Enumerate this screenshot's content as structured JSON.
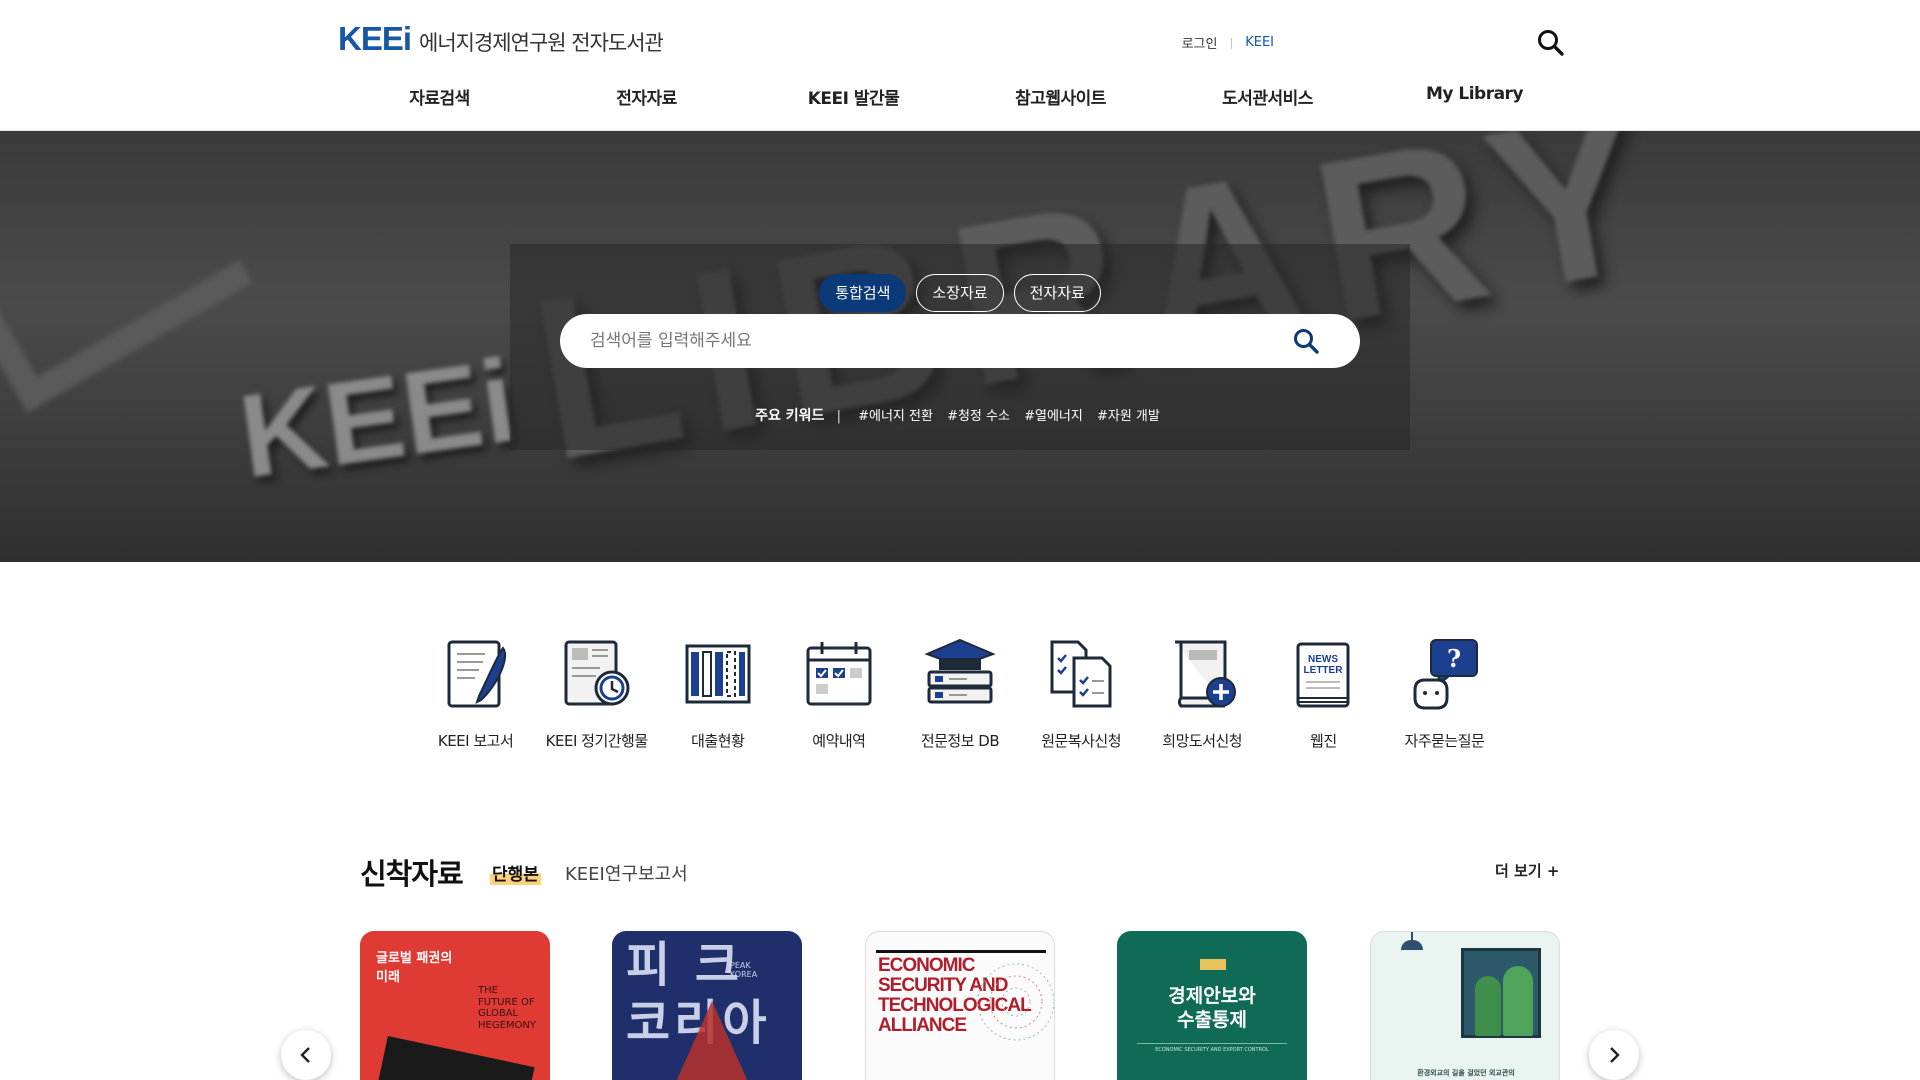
{
  "header": {
    "logo_mark": "KEEi",
    "logo_text": "에너지경제연구원 전자도서관",
    "login_label": "로그인",
    "keei_link": "KEEI",
    "nav": [
      "자료검색",
      "전자자료",
      "KEEI 발간물",
      "참고웹사이트",
      "도서관서비스",
      "My Library"
    ]
  },
  "hero": {
    "bg_keei": "KEEi",
    "bg_library": "LIBRARY",
    "tabs": [
      "통합검색",
      "소장자료",
      "전자자료"
    ],
    "active_tab": "통합검색",
    "search_placeholder": "검색어를 입력해주세요",
    "keywords_title": "주요 키워드",
    "keywords": [
      "#에너지 전환",
      "#청정 수소",
      "#열에너지",
      "#자원 개발"
    ]
  },
  "quick_menu": [
    {
      "label": "KEEI 보고서",
      "icon": "report-pen-icon"
    },
    {
      "label": "KEEI 정기간행물",
      "icon": "periodical-clock-icon"
    },
    {
      "label": "대출현황",
      "icon": "bookshelf-icon"
    },
    {
      "label": "예약내역",
      "icon": "calendar-icon"
    },
    {
      "label": "전문정보 DB",
      "icon": "graduation-db-icon"
    },
    {
      "label": "원문복사신청",
      "icon": "document-copy-icon"
    },
    {
      "label": "희망도서신청",
      "icon": "book-add-icon"
    },
    {
      "label": "웹진",
      "icon": "newsletter-icon"
    },
    {
      "label": "자주묻는질문",
      "icon": "faq-icon"
    }
  ],
  "newsletter_icon_text": "NEWS\nLETTER",
  "faq_icon_text": "?",
  "new_arrivals": {
    "title": "신착자료",
    "tab_active": "단행본",
    "tab_other": "KEEI연구보고서",
    "more_label": "더 보기 +",
    "books": [
      {
        "title": "글로벌 패권의\n미래",
        "subtitle": "THE\nFUTURE OF\nGLOBAL\nHEGEMONY"
      },
      {
        "title": "피  크\n코리아",
        "subtitle": "PEAK\nKOREA"
      },
      {
        "title": "ECONOMIC\nSECURITY AND\nTECHNOLOGICAL\nALLIANCE",
        "subtitle": ""
      },
      {
        "title": "경제안보와\n수출통제",
        "subtitle": "ECONOMIC SECURITY AND EXPORT CONTROL"
      },
      {
        "title": "",
        "subtitle": "환경외교의 길을 걸었던 외교관의"
      }
    ]
  },
  "colors": {
    "brand_blue": "#1658a6",
    "active_tab": "#0c3a78",
    "highlight": "#ffd27a"
  }
}
